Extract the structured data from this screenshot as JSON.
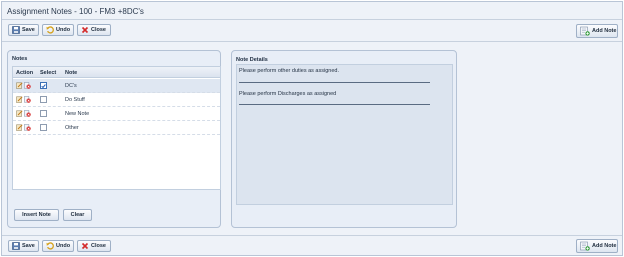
{
  "window": {
    "title": "Assignment Notes - 100 - FM3 +8DC's"
  },
  "toolbar": {
    "save": "Save",
    "undo": "Undo",
    "close": "Close",
    "add_note": "Add Note"
  },
  "notes_panel": {
    "title": "Notes",
    "columns": {
      "action": "Action",
      "select": "Select",
      "note": "Note"
    },
    "rows": [
      {
        "note": "DC's",
        "selected": true
      },
      {
        "note": "Do Stuff",
        "selected": false
      },
      {
        "note": "New Note",
        "selected": false
      },
      {
        "note": "Other",
        "selected": false
      }
    ],
    "insert_button": "Insert Note",
    "clear_button": "Clear"
  },
  "details_panel": {
    "title": "Note Details",
    "lines": [
      "Please perform other duties as assigned.",
      "Please perform Discharges as assigned"
    ]
  },
  "icons": [
    "save-icon",
    "undo-icon",
    "close-icon",
    "add-note-icon",
    "edit-icon",
    "delete-icon",
    "check-icon"
  ],
  "colors": {
    "accent": "#3a6fb5",
    "panel": "#e8eef7",
    "background": "#eef2f8"
  }
}
